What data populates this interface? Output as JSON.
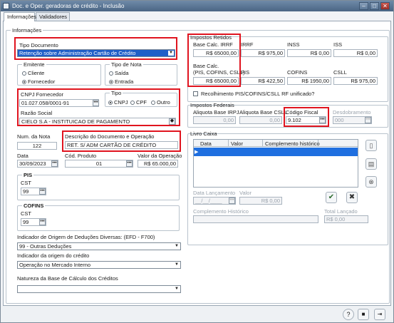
{
  "window": {
    "title": "Doc. e Oper. geradoras de crédito - Inclusão",
    "min": "–",
    "max": "□",
    "close": "✕"
  },
  "tabs": [
    "Informações",
    "Validadores"
  ],
  "info_group": "Informações",
  "tipo_documento": {
    "label": "Tipo Documento",
    "value": "Retenção sobre Administração Cartão de Crédito"
  },
  "emitente": {
    "label": "Emitente",
    "options": [
      "Cliente",
      "Fornecedor"
    ],
    "selected": "Fornecedor"
  },
  "tipo_nota": {
    "label": "Tipo de Nota",
    "options": [
      "Saída",
      "Entrada"
    ],
    "selected": "Entrada"
  },
  "cnpj": {
    "label": "CNPJ Fornecedor",
    "value": "01.027.058/0001-91"
  },
  "tipo": {
    "label": "Tipo",
    "options": [
      "CNPJ",
      "CPF",
      "Outro"
    ],
    "selected": "CNPJ"
  },
  "razao_social": {
    "label": "Razão Social",
    "value": "CIELO S.A - INSTITUICAO DE PAGAMENTO"
  },
  "num_nota": {
    "label": "Num. da Nota",
    "value": "122"
  },
  "descricao": {
    "label": "Descrição do Documento e Operação",
    "value": "RET. S/ ADM CARTÃO DE CRÉDITO"
  },
  "data": {
    "label": "Data",
    "value": "30/09/2023"
  },
  "cod_produto": {
    "label": "Cód. Produto",
    "value": "01"
  },
  "valor_operacao": {
    "label": "Valor da Operação",
    "value": "R$ 65.000,00"
  },
  "pis": {
    "title": "PIS",
    "cst_label": "CST",
    "cst_value": "99"
  },
  "cofins": {
    "title": "COFINS",
    "cst_label": "CST",
    "cst_value": "99"
  },
  "indicador_origem_deducoes": {
    "label": "Indicador de Origem de Deduções Diversas: (EFD - F700)",
    "value": "99 - Outras Deduções"
  },
  "indicador_origem_credito": {
    "label": "Indicador da origem do crédito",
    "value": "Operação no Mercado Interno"
  },
  "natureza_base": {
    "label": "Natureza da Base de Cálculo dos Créditos",
    "value": ""
  },
  "impostos_retidos": {
    "title": "Impostos Retidos",
    "base_irrf_label": "Base Calc. IRRF",
    "base_irrf_value": "R$ 65000,00",
    "irrf_label": "IRRF",
    "irrf_value": "R$ 975,00",
    "inss_label": "INSS",
    "inss_value": "R$ 0,00",
    "iss_label": "ISS",
    "iss_value": "R$ 0,00",
    "base_pis_label_1": "Base Calc.",
    "base_pis_label_2": "(PIS, COFINS, CSLL)",
    "base_pis_value": "R$ 65000,00",
    "pis_label": "PIS",
    "pis_value": "R$ 422,50",
    "cofins_label": "COFINS",
    "cofins_value": "R$ 1950,00",
    "csll_label": "CSLL",
    "csll_value": "R$ 975,00",
    "unificado_label": "Recolhimento PIS/COFINS/CSLL RF unificado?"
  },
  "impostos_federais": {
    "title": "Impostos Federais",
    "aliq_irpj_label": "Aliquota Base IRPJ",
    "aliq_irpj_value": "0,00",
    "aliq_csll_label": "Aliquota Base CSLL",
    "aliq_csll_value": "0,00",
    "codigo_fiscal_label": "Código Fiscal",
    "codigo_fiscal_value": "9.102",
    "desdobramento_label": "Desdobramento",
    "desdobramento_value": "000"
  },
  "livro_caixa": {
    "title": "Livro Caixa",
    "columns": [
      "Data",
      "Valor",
      "Complemento histórico"
    ],
    "data_lancamento_label": "Data Lançamento",
    "data_lancamento_value": "__/__/____",
    "valor_label": "Valor",
    "valor_value": "R$ 0,00",
    "complemento_label": "Complemento Histórico",
    "total_label": "Total Lançado",
    "total_value": "R$ 0,00"
  },
  "icons": {
    "help": "?",
    "save": "■",
    "exit": "⇥"
  }
}
